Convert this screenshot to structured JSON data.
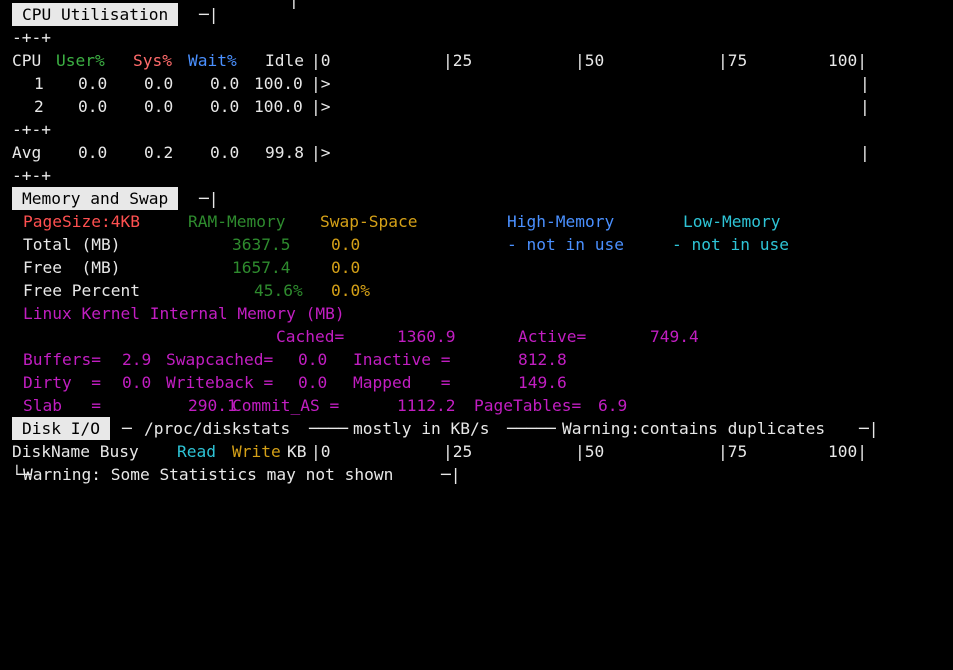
{
  "top_fragment": "|",
  "cpu": {
    "header": "CPU Utilisation",
    "sep": "-+-+",
    "col_cpu": "CPU",
    "col_user": "User%",
    "col_sys": "Sys%",
    "col_wait": "Wait%",
    "col_idle": "Idle",
    "scale": [
      "|0",
      "|25",
      "|50",
      "|75",
      "100|"
    ],
    "rows": [
      {
        "id": "1",
        "user": "0.0",
        "sys": "0.0",
        "wait": "0.0",
        "idle": "100.0",
        "bar": "|>"
      },
      {
        "id": "2",
        "user": "0.0",
        "sys": "0.0",
        "wait": "0.0",
        "idle": "100.0",
        "bar": "|>"
      }
    ],
    "avg": {
      "id": "Avg",
      "user": "0.0",
      "sys": "0.2",
      "wait": "0.0",
      "idle": "99.8",
      "bar": "|>"
    },
    "end_bar": "|"
  },
  "memory": {
    "header": "Memory and Swap",
    "pagesize": "PageSize:4KB",
    "ram_label": "RAM-Memory",
    "swap_label": "Swap-Space",
    "high_label": "High-Memory",
    "low_label": "Low-Memory",
    "total_label": "Total (MB)",
    "total_ram": "3637.5",
    "total_swap": "0.0",
    "not_in_use_high": "- not in use",
    "not_in_use_low": "- not in use",
    "free_label": "Free  (MB)",
    "free_ram": "1657.4",
    "free_swap": "0.0",
    "freepct_label": "Free Percent",
    "freepct_ram": "45.6%",
    "freepct_swap": "0.0%",
    "kernel_title": "Linux Kernel Internal Memory (MB)",
    "cached_label": "Cached=",
    "cached_val": "1360.9",
    "active_label": "Active=",
    "active_val": "749.4",
    "buffers_label": "Buffers=",
    "buffers_val": "2.9",
    "swapcached_label": "Swapcached=",
    "swapcached_val": "0.0",
    "inactive_label": "Inactive =",
    "inactive_val": "812.8",
    "dirty_label": "Dirty  =",
    "dirty_val": "0.0",
    "writeback_label": "Writeback =",
    "writeback_val": "0.0",
    "mapped_label": "Mapped   =",
    "mapped_val": "149.6",
    "slab_label": "Slab   =",
    "slab_val": "290.1",
    "commit_label": "Commit_AS =",
    "commit_val": "1112.2",
    "pagetables_label": "PageTables=",
    "pagetables_val": "6.9"
  },
  "disk": {
    "header": "Disk I/O",
    "path": "/proc/diskstats",
    "unit_note": "mostly in KB/s",
    "warning_dup": "Warning:contains duplicates",
    "col_name": "DiskName Busy",
    "col_read": "Read",
    "col_write": "Write",
    "col_kb": "KB",
    "scale": [
      "|0",
      "|25",
      "|50",
      "|75",
      "100|"
    ],
    "warning_stats": "Warning: Some Statistics may not shown"
  }
}
